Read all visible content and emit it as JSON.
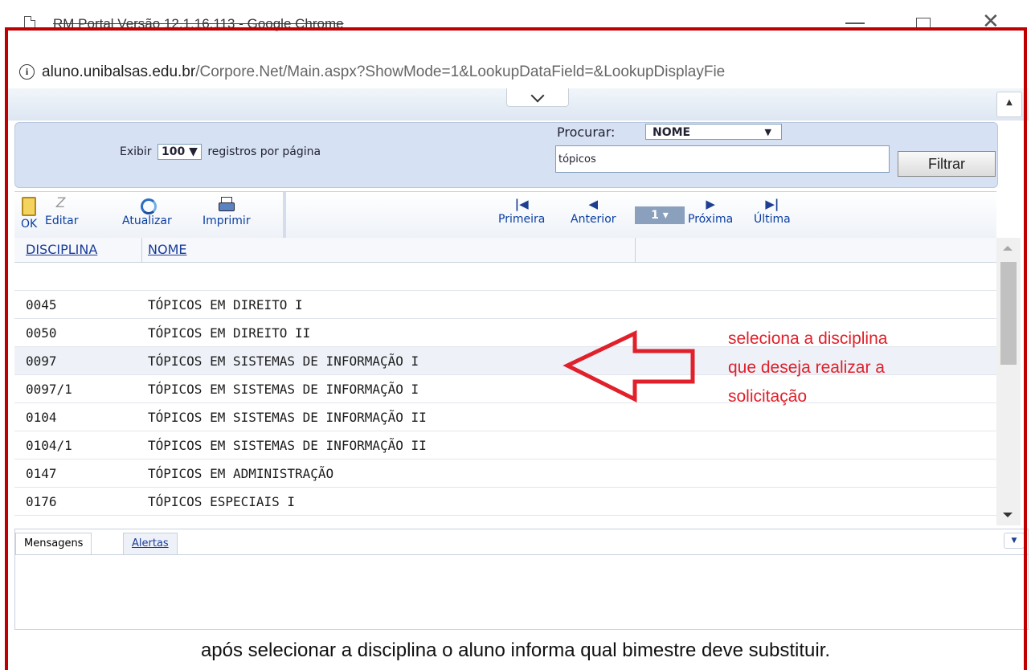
{
  "window": {
    "title": "RM Portal Versão 12.1.16.113 - Google Chrome",
    "url_host": "aluno.unibalsas.edu.br",
    "url_path": "/Corpore.Net/Main.aspx?ShowMode=1&LookupDataField=&LookupDisplayFie"
  },
  "filter": {
    "exibir_label": "Exibir",
    "page_size": "100",
    "page_size_suffix": "registros por página",
    "procurar_label": "Procurar:",
    "procurar_field": "NOME",
    "search_value": "tópicos",
    "filtrar_label": "Filtrar"
  },
  "toolbar": {
    "ok": "OK",
    "editar": "Editar",
    "atualizar": "Atualizar",
    "imprimir": "Imprimir",
    "primeira": "Primeira",
    "anterior": "Anterior",
    "page": "1",
    "proxima": "Próxima",
    "ultima": "Última"
  },
  "grid": {
    "columns": [
      "DISCIPLINA",
      "NOME"
    ],
    "rows": [
      {
        "code": "0045",
        "name": "TÓPICOS EM DIREITO I"
      },
      {
        "code": "0050",
        "name": "TÓPICOS EM DIREITO II"
      },
      {
        "code": "0097",
        "name": "TÓPICOS EM SISTEMAS DE INFORMAÇÃO I"
      },
      {
        "code": "0097/1",
        "name": "TÓPICOS EM SISTEMAS DE INFORMAÇÃO I"
      },
      {
        "code": "0104",
        "name": "TÓPICOS EM SISTEMAS DE INFORMAÇÃO II"
      },
      {
        "code": "0104/1",
        "name": "TÓPICOS EM SISTEMAS DE INFORMAÇÃO II"
      },
      {
        "code": "0147",
        "name": "TÓPICOS EM ADMINISTRAÇÃO"
      },
      {
        "code": "0176",
        "name": "TÓPICOS ESPECIAIS I"
      }
    ],
    "selected_index": 2
  },
  "messages": {
    "tab_mensagens": "Mensagens",
    "tab_alertas": "Alertas"
  },
  "annotation": {
    "line1": "seleciona a disciplina",
    "line2": "que deseja realizar a",
    "line3": "solicitação",
    "color": "#e0202a"
  },
  "caption": "após selecionar a disciplina o aluno informa qual bimestre deve substituir."
}
